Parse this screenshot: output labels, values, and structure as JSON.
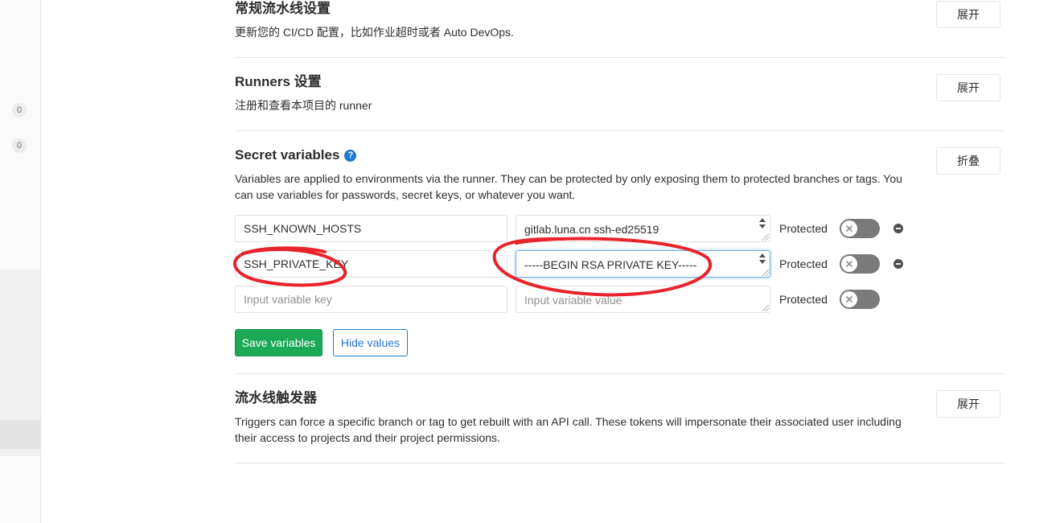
{
  "colors": {
    "success": "#1aaa55",
    "success_border": "#168f48",
    "primary": "#1f78d1",
    "annotation": "#e8232a",
    "toggle_off": "#7a7a7a"
  },
  "icons": {
    "help": "question-circle-icon",
    "toggle_knob": "close-icon",
    "remove": "minus-circle-icon"
  },
  "sidebar": {
    "badges": [
      "0",
      "0"
    ]
  },
  "sections": {
    "general_pipelines": {
      "title": "常规流水线设置",
      "description": "更新您的 CI/CD 配置，比如作业超时或者 Auto DevOps.",
      "toggle_label": "展开"
    },
    "runners": {
      "title": "Runners 设置",
      "description": "注册和查看本项目的 runner",
      "toggle_label": "展开"
    },
    "secret_variables": {
      "title": "Secret variables",
      "help_glyph": "?",
      "description": "Variables are applied to environments via the runner. They can be protected by only exposing them to protected branches or tags. You can use variables for passwords, secret keys, or whatever you want.",
      "toggle_label": "折叠",
      "protected_label": "Protected",
      "variables": [
        {
          "key": "SSH_KNOWN_HOSTS",
          "value": "gitlab.luna.cn ssh-ed25519",
          "protected": false
        },
        {
          "key": "SSH_PRIVATE_KEY",
          "value": "-----BEGIN RSA PRIVATE KEY-----",
          "protected": false
        }
      ],
      "new_variable": {
        "key_placeholder": "Input variable key",
        "value_placeholder": "Input variable value",
        "protected": false
      },
      "save_label": "Save variables",
      "hide_values_label": "Hide values"
    },
    "pipeline_triggers": {
      "title": "流水线触发器",
      "description": "Triggers can force a specific branch or tag to get rebuilt with an API call. These tokens will impersonate their associated user including their access to projects and their project permissions.",
      "toggle_label": "展开"
    }
  }
}
